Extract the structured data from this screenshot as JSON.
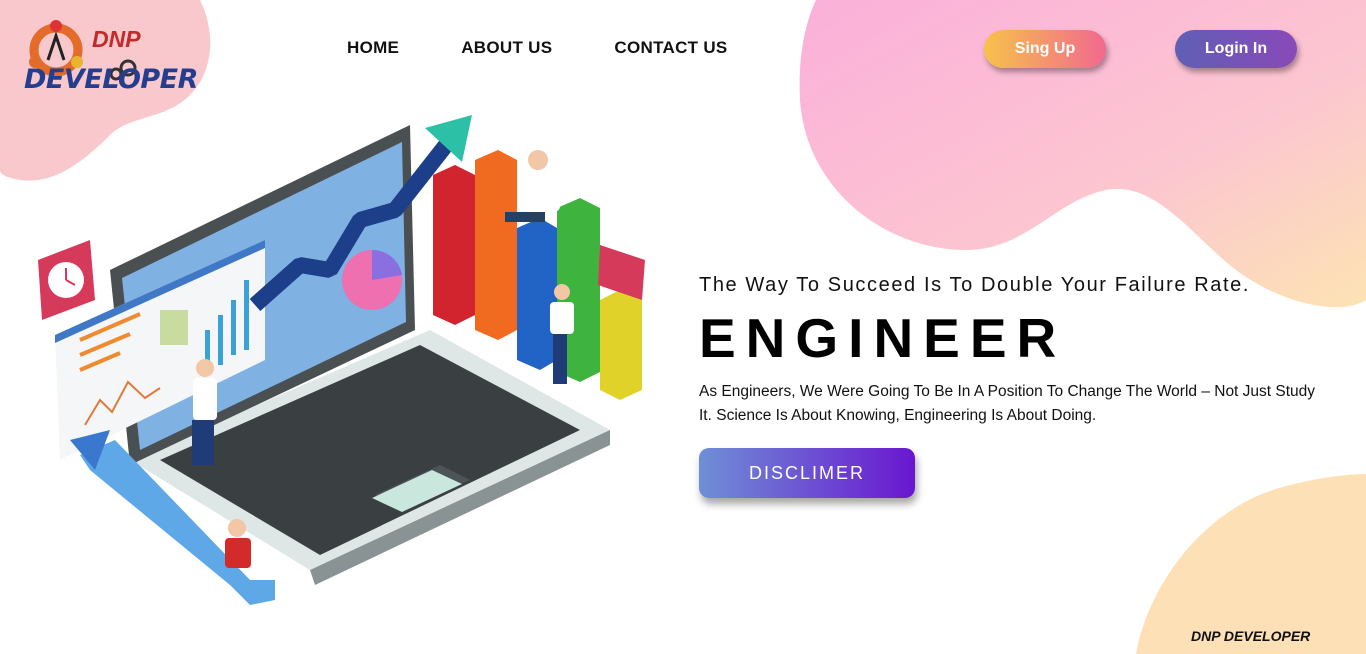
{
  "logo": {
    "top": "DNP",
    "bottom": "DEVELOPER"
  },
  "nav": {
    "home": "HOME",
    "about": "ABOUT US",
    "contact": "CONTACT US"
  },
  "auth": {
    "signup": "Sing Up",
    "login": "Login In"
  },
  "hero": {
    "tagline": "The Way To Succeed Is To Double Your Failure Rate.",
    "headline": "ENGINEER",
    "description": "As Engineers, We Were Going To Be In A Position To Change The World – Not Just Study It. Science Is About Knowing, Engineering Is About Doing.",
    "cta": "DISCLIMER"
  },
  "footer": {
    "brand": "DNP DEVELOPER"
  },
  "colors": {
    "pink_blob": "#f6c8cf",
    "pink_gradient": "#fbb3d6",
    "peach_blob": "#fde0b5"
  }
}
